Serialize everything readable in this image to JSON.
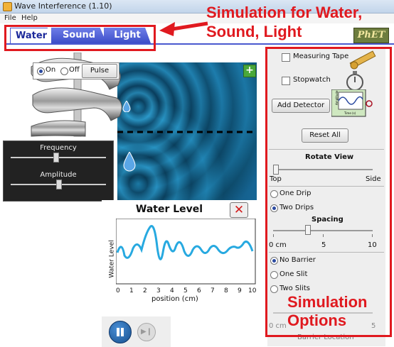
{
  "window": {
    "title": "Wave Interference (1.10)"
  },
  "menu": [
    "File",
    "Help"
  ],
  "tabs": [
    {
      "label": "Water",
      "active": true
    },
    {
      "label": "Sound",
      "active": false
    },
    {
      "label": "Light",
      "active": false
    }
  ],
  "logo": "PhET",
  "annotations": {
    "top_line1": "Simulation for Water,",
    "top_line2": "Sound, Light",
    "side_line1": "Simulation",
    "side_line2": "Options",
    "color": "#e0191f"
  },
  "source_controls": {
    "on_label": "On",
    "off_label": "Off",
    "selected": "On",
    "pulse_label": "Pulse",
    "frequency_label": "Frequency",
    "amplitude_label": "Amplitude"
  },
  "zoom_icon": "plus-icon",
  "graph": {
    "title": "Water Level",
    "close_icon": "close-x-icon",
    "ylabel": "Water Level",
    "xlabel": "position (cm)",
    "x_ticks": [
      "0",
      "1",
      "2",
      "3",
      "4",
      "5",
      "6",
      "7",
      "8",
      "9",
      "10"
    ]
  },
  "playback": {
    "pause_icon": "pause-icon",
    "step_icon": "step-icon"
  },
  "options": {
    "measuring_tape": "Measuring Tape",
    "stopwatch": "Stopwatch",
    "add_detector": "Add Detector",
    "reset_all": "Reset All",
    "rotate_view": "Rotate View",
    "rotate_top": "Top",
    "rotate_side": "Side",
    "one_drip": "One Drip",
    "two_drips": "Two Drips",
    "drips_selected": "Two Drips",
    "spacing": "Spacing",
    "spacing_ticks": [
      "0 cm",
      "5",
      "10"
    ],
    "no_barrier": "No Barrier",
    "one_slit": "One Slit",
    "two_slits": "Two Slits",
    "barrier_selected": "No Barrier",
    "barrier_ticks": [
      "0 cm",
      "5"
    ],
    "barrier_location": "Barrier Location",
    "detector_chart_labels": {
      "y": "Amplitude",
      "x": "Time (s)"
    }
  }
}
